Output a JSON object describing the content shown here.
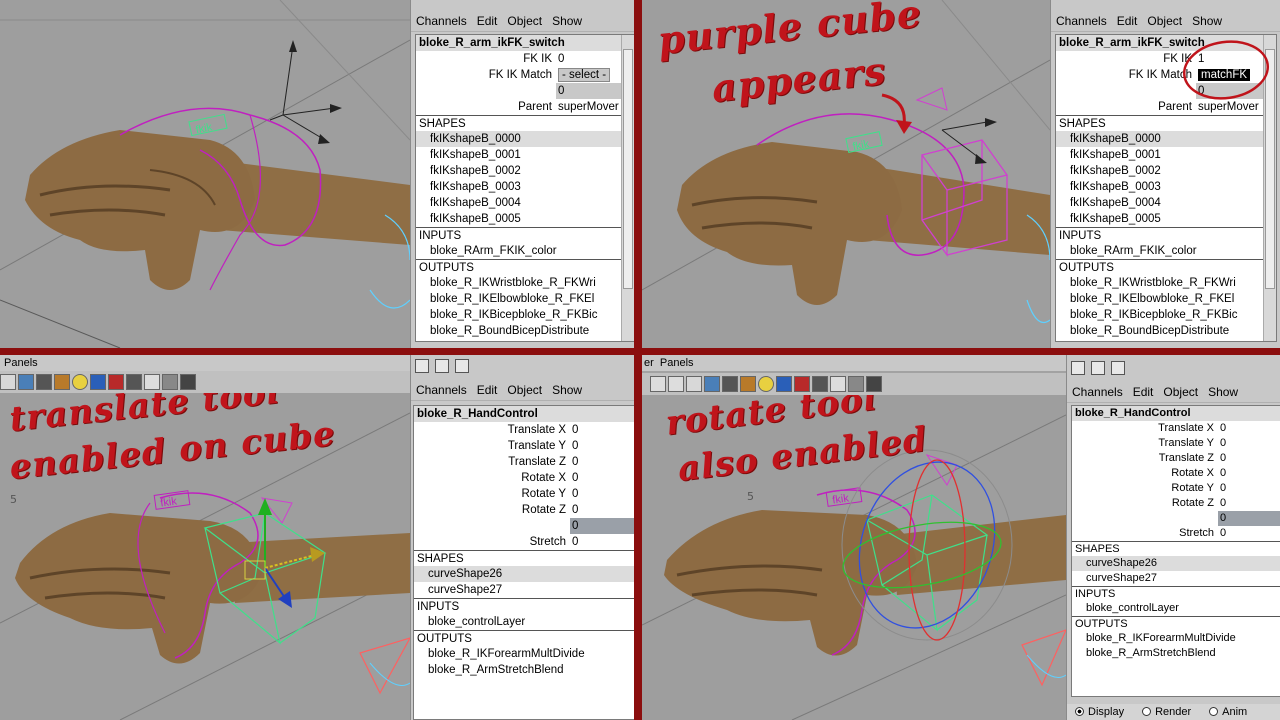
{
  "menus": {
    "channels": "Channels",
    "edit": "Edit",
    "object": "Object",
    "show": "Show"
  },
  "panels_menu": {
    "q3": "Panels",
    "q4_prefix": "er",
    "q4": "Panels"
  },
  "annotations": {
    "q2_line1": "purple cube",
    "q2_line2": "appears",
    "q3_line1": "translate tool",
    "q3_line2": "enabled on cube",
    "q4_line1": "rotate tool",
    "q4_line2": "also enabled"
  },
  "viewport_labels": {
    "q3_grid": "5",
    "q4_grid": "5",
    "fkik_text": "fkik"
  },
  "q1": {
    "object": "bloke_R_arm_ikFK_switch",
    "fkik_label": "FK IK",
    "fkik_value": "0",
    "match_label": "FK IK Match",
    "match_value": "- select -",
    "blank_value": "0",
    "parent_label": "Parent",
    "parent_value": "superMover",
    "shapes_header": "SHAPES",
    "shapes": [
      "fkIKshapeB_0000",
      "fkIKshapeB_0001",
      "fkIKshapeB_0002",
      "fkIKshapeB_0003",
      "fkIKshapeB_0004",
      "fkIKshapeB_0005"
    ],
    "inputs_header": "INPUTS",
    "inputs": [
      "bloke_RArm_FKIK_color"
    ],
    "outputs_header": "OUTPUTS",
    "outputs": [
      "bloke_R_IKWristbloke_R_FKWri",
      "bloke_R_IKElbowbloke_R_FKEl",
      "bloke_R_IKBicepbloke_R_FKBic",
      "bloke_R_BoundBicepDistribute"
    ]
  },
  "q2": {
    "object": "bloke_R_arm_ikFK_switch",
    "fkik_label": "FK IK",
    "fkik_value": "1",
    "match_label": "FK IK Match",
    "match_value": "matchFK",
    "blank_value": "0",
    "parent_label": "Parent",
    "parent_value": "superMover",
    "shapes_header": "SHAPES",
    "shapes": [
      "fkIKshapeB_0000",
      "fkIKshapeB_0001",
      "fkIKshapeB_0002",
      "fkIKshapeB_0003",
      "fkIKshapeB_0004",
      "fkIKshapeB_0005"
    ],
    "inputs_header": "INPUTS",
    "inputs": [
      "bloke_RArm_FKIK_color"
    ],
    "outputs_header": "OUTPUTS",
    "outputs": [
      "bloke_R_IKWristbloke_R_FKWri",
      "bloke_R_IKElbowbloke_R_FKEl",
      "bloke_R_IKBicepbloke_R_FKBic",
      "bloke_R_BoundBicepDistribute"
    ]
  },
  "q3": {
    "object": "bloke_R_HandControl",
    "attrs": [
      {
        "label": "Translate X",
        "value": "0"
      },
      {
        "label": "Translate Y",
        "value": "0"
      },
      {
        "label": "Translate Z",
        "value": "0"
      },
      {
        "label": "Rotate X",
        "value": "0"
      },
      {
        "label": "Rotate Y",
        "value": "0"
      },
      {
        "label": "Rotate Z",
        "value": "0"
      }
    ],
    "blank_value": "0",
    "stretch_label": "Stretch",
    "stretch_value": "0",
    "shapes_header": "SHAPES",
    "shapes": [
      "curveShape26",
      "curveShape27"
    ],
    "inputs_header": "INPUTS",
    "inputs": [
      "bloke_controlLayer"
    ],
    "outputs_header": "OUTPUTS",
    "outputs": [
      "bloke_R_IKForearmMultDivide",
      "bloke_R_ArmStretchBlend"
    ]
  },
  "q4": {
    "object": "bloke_R_HandControl",
    "attrs": [
      {
        "label": "Translate X",
        "value": "0"
      },
      {
        "label": "Translate Y",
        "value": "0"
      },
      {
        "label": "Translate Z",
        "value": "0"
      },
      {
        "label": "Rotate X",
        "value": "0"
      },
      {
        "label": "Rotate Y",
        "value": "0"
      },
      {
        "label": "Rotate Z",
        "value": "0"
      }
    ],
    "blank_value": "0",
    "stretch_label": "Stretch",
    "stretch_value": "0",
    "shapes_header": "SHAPES",
    "shapes": [
      "curveShape26",
      "curveShape27"
    ],
    "inputs_header": "INPUTS",
    "inputs": [
      "bloke_controlLayer"
    ],
    "outputs_header": "OUTPUTS",
    "outputs": [
      "bloke_R_IKForearmMultDivide",
      "bloke_R_ArmStretchBlend"
    ]
  },
  "bottom": {
    "display": "Display",
    "render": "Render",
    "anim": "Anim"
  },
  "colors": {
    "divider": "#8b0e0e",
    "annotation": "#c0141b",
    "hand": "#8a6a44",
    "fkik_curve": "#c020c0",
    "cube_green": "#3fe08a"
  }
}
